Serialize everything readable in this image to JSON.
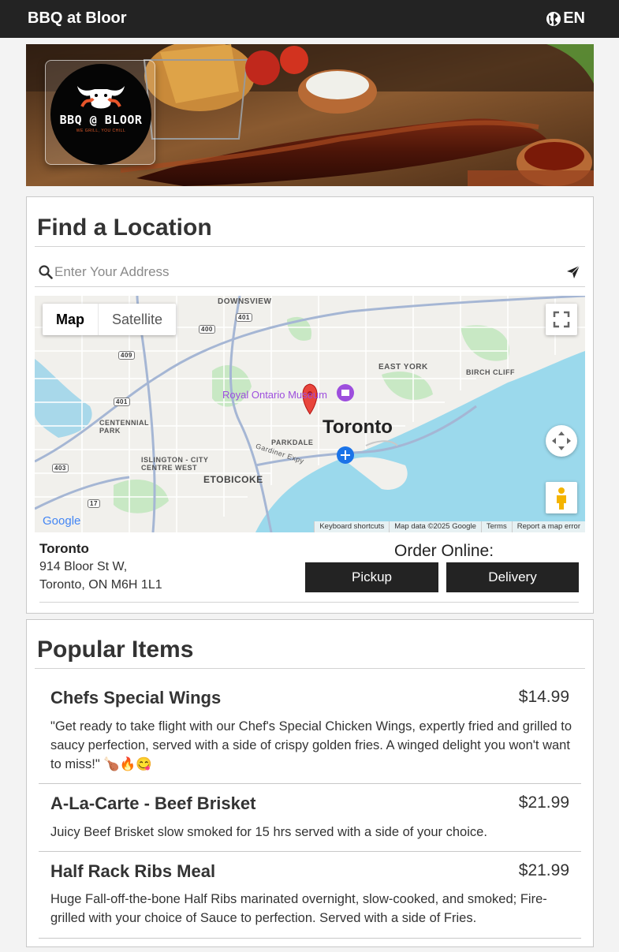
{
  "header": {
    "brand": "BBQ at Bloor",
    "language": "EN"
  },
  "hero": {
    "logo_text": "BBQ @ BLOOR",
    "logo_tagline": "WE GRILL, YOU CHILL"
  },
  "locator": {
    "title": "Find a Location",
    "search_placeholder": "Enter Your Address",
    "map": {
      "type_options": [
        "Map",
        "Satellite"
      ],
      "selected_type": "Map",
      "city_label": "Toronto",
      "poi_label": "Royal Ontario Museum",
      "place_labels": [
        "DOWNSVIEW",
        "EAST YORK",
        "BIRCH CLIFF",
        "CENTENNIAL PARK",
        "PARKDALE",
        "ISLINGTON - CITY CENTRE WEST",
        "ETOBICOKE"
      ],
      "road_shields": [
        "401",
        "400",
        "409",
        "401",
        "403",
        "17"
      ],
      "street_label": "Gardiner Expy",
      "footer": [
        "Keyboard shortcuts",
        "Map data ©2025 Google",
        "Terms",
        "Report a map error"
      ],
      "google_logo": "Google"
    },
    "location": {
      "name": "Toronto",
      "address_line1": "914 Bloor St W,",
      "address_line2": "Toronto, ON M6H 1L1"
    },
    "order": {
      "label": "Order Online:",
      "pickup": "Pickup",
      "delivery": "Delivery"
    }
  },
  "popular": {
    "title": "Popular Items",
    "items": [
      {
        "name": "Chefs Special Wings",
        "price": "$14.99",
        "description": "\"Get ready to take flight with our Chef's Special Chicken Wings, expertly fried and grilled to saucy perfection, served with a side of crispy golden fries. A winged delight you won't want to miss!\" 🍗🔥😋"
      },
      {
        "name": "A-La-Carte - Beef Brisket",
        "price": "$21.99",
        "description": "Juicy Beef Brisket slow smoked for 15 hrs served with a side of your choice."
      },
      {
        "name": "Half Rack Ribs Meal",
        "price": "$21.99",
        "description": "Huge Fall-off-the-bone Half Ribs marinated overnight, slow-cooked, and smoked; Fire-grilled with your choice of Sauce to perfection. Served with a side of Fries."
      }
    ]
  },
  "colors": {
    "header_bg": "#232323",
    "button_bg": "#232323",
    "map_water": "#9bd9ec",
    "map_pin": "#e8453c"
  }
}
